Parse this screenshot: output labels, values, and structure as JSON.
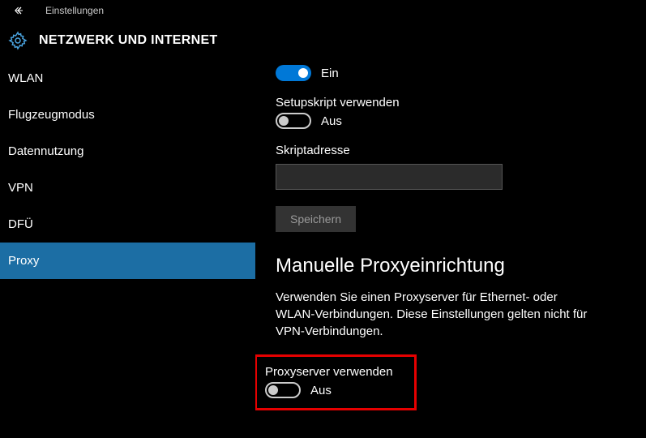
{
  "titlebar": {
    "title": "Einstellungen"
  },
  "header": {
    "title": "NETZWERK UND INTERNET"
  },
  "sidebar": {
    "items": [
      {
        "label": "WLAN"
      },
      {
        "label": "Flugzeugmodus"
      },
      {
        "label": "Datennutzung"
      },
      {
        "label": "VPN"
      },
      {
        "label": "DFÜ"
      },
      {
        "label": "Proxy"
      }
    ],
    "active_index": 5
  },
  "content": {
    "toggle_on_label": "Ein",
    "setup_script_label": "Setupskript verwenden",
    "setup_script_toggle_label": "Aus",
    "script_address_label": "Skriptadresse",
    "save_button": "Speichern",
    "manual_section_title": "Manuelle Proxyeinrichtung",
    "manual_section_desc": "Verwenden Sie einen Proxyserver für Ethernet- oder WLAN-Verbindungen. Diese Einstellungen gelten nicht für VPN-Verbindungen.",
    "use_proxy_label": "Proxyserver verwenden",
    "use_proxy_toggle_label": "Aus"
  }
}
